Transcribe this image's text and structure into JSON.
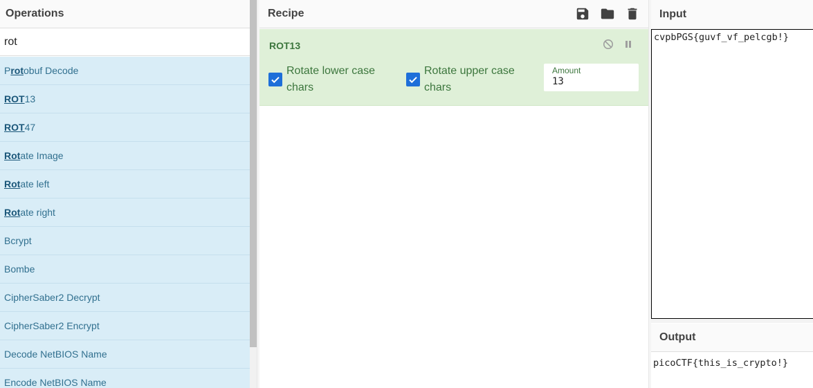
{
  "operations": {
    "title": "Operations",
    "search_value": "rot",
    "items": [
      {
        "pre": "P",
        "hl": "rot",
        "post": "obuf Decode"
      },
      {
        "pre": "",
        "hl": "ROT",
        "post": "13"
      },
      {
        "pre": "",
        "hl": "ROT",
        "post": "47"
      },
      {
        "pre": "",
        "hl": "Rot",
        "post": "ate Image"
      },
      {
        "pre": "",
        "hl": "Rot",
        "post": "ate left"
      },
      {
        "pre": "",
        "hl": "Rot",
        "post": "ate right"
      },
      {
        "pre": "Bcrypt",
        "hl": "",
        "post": ""
      },
      {
        "pre": "Bombe",
        "hl": "",
        "post": ""
      },
      {
        "pre": "CipherSaber2 Decrypt",
        "hl": "",
        "post": ""
      },
      {
        "pre": "CipherSaber2 Encrypt",
        "hl": "",
        "post": ""
      },
      {
        "pre": "Decode NetBIOS Name",
        "hl": "",
        "post": ""
      },
      {
        "pre": "Encode NetBIOS Name",
        "hl": "",
        "post": ""
      }
    ]
  },
  "recipe": {
    "title": "Recipe",
    "icons": [
      "save-icon",
      "folder-icon",
      "trash-icon"
    ],
    "operation": {
      "name": "ROT13",
      "lower_label": "Rotate lower case chars",
      "lower_checked": true,
      "upper_label": "Rotate upper case chars",
      "upper_checked": true,
      "amount_label": "Amount",
      "amount_value": "13"
    }
  },
  "io": {
    "input_title": "Input",
    "input_value": "cvpbPGS{guvf_vf_pelcgb!}",
    "output_title": "Output",
    "output_value": "picoCTF{this_is_crypto!}"
  },
  "colors": {
    "accent_blue": "#1e6fd9",
    "ops_list_bg": "#d9edf7",
    "recipe_block_bg": "#dff0d8",
    "recipe_text": "#3c763d"
  }
}
